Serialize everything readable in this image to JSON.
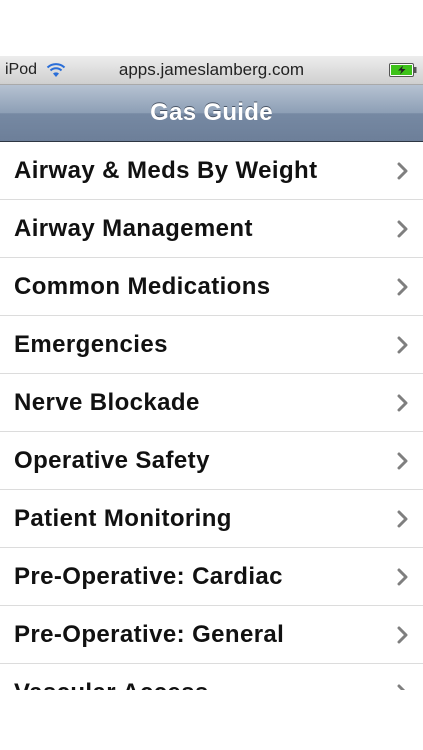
{
  "status_bar": {
    "carrier": "iPod",
    "url": "apps.jameslamberg.com",
    "wifi_icon": "wifi-icon",
    "battery_icon": "battery-charging-icon",
    "battery_color": "#3ec21a"
  },
  "nav": {
    "title": "Gas Guide"
  },
  "menu": {
    "chevron_icon": "chevron-right-icon",
    "items": [
      {
        "label": "Airway & Meds By Weight"
      },
      {
        "label": "Airway Management"
      },
      {
        "label": "Common Medications"
      },
      {
        "label": "Emergencies"
      },
      {
        "label": "Nerve Blockade"
      },
      {
        "label": "Operative Safety"
      },
      {
        "label": "Patient Monitoring"
      },
      {
        "label": "Pre-Operative: Cardiac"
      },
      {
        "label": "Pre-Operative: General"
      },
      {
        "label": "Vascular Access"
      }
    ]
  },
  "colors": {
    "nav_gradient_top": "#b6c2d2",
    "nav_gradient_bottom": "#6d7f99",
    "separator": "#dcdcdc",
    "chevron": "#7f7f7f"
  }
}
